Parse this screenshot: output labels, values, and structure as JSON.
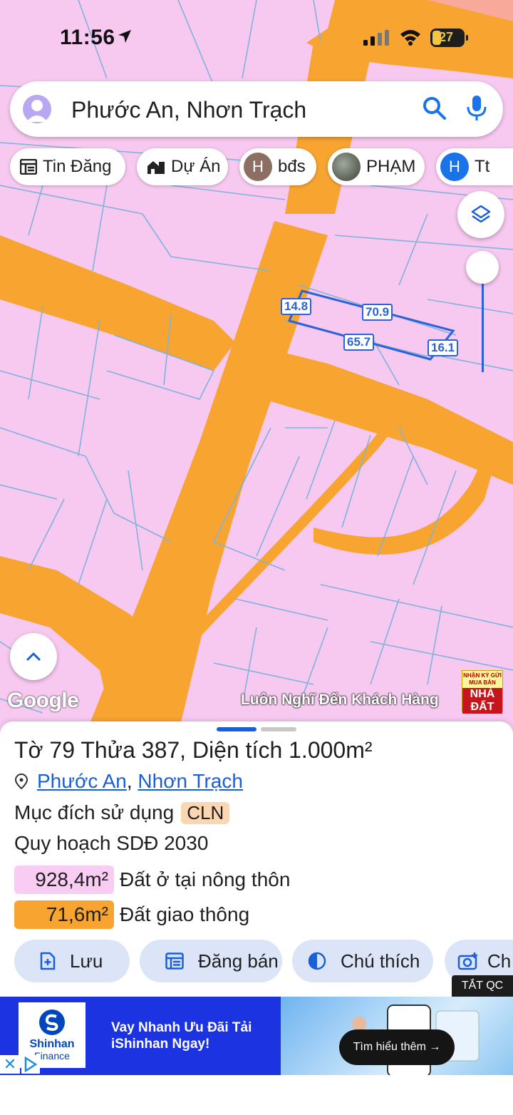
{
  "status_bar": {
    "time": "11:56",
    "battery": "27"
  },
  "search": {
    "query": "Phước An, Nhơn Trạch"
  },
  "chips": [
    {
      "label": "Tin Đăng",
      "icon": "listing-icon"
    },
    {
      "label": "Dự Án",
      "icon": "project-icon"
    },
    {
      "label": "bđs",
      "badge": "H",
      "badge_color": "#8d6e63"
    },
    {
      "label": "PHẠM",
      "icon": "photo-avatar"
    },
    {
      "label": "Tt",
      "badge": "H",
      "badge_color": "#1a73e8"
    }
  ],
  "map": {
    "dimensions": [
      "14.8",
      "70.9",
      "65.7",
      "16.1"
    ],
    "google_logo": "Google",
    "watermark": "Luôn Nghĩ Đến Khách Hàng",
    "watermark_badge_top": "NHẬN KÝ GỬI MUA BÁN",
    "watermark_badge_main": "NHÀ ĐẤT"
  },
  "parcel": {
    "title_prefix": "Tờ",
    "sheet_no": "79",
    "title_mid": "Thửa",
    "parcel_no": "387",
    "title_area_label": ", Diện tích",
    "area": "1.000m²",
    "ward": "Phước An",
    "district": "Nhơn Trạch",
    "purpose_label": "Mục đích sử dụng",
    "purpose_code": "CLN",
    "plan_label": "Quy hoạch SDĐ 2030",
    "areas": [
      {
        "value": "928,4m²",
        "label": "Đất ở tại nông thôn",
        "color": "#f9ccf3"
      },
      {
        "value": "71,6m²",
        "label": "Đất giao thông",
        "color": "#f7a431"
      }
    ]
  },
  "actions": [
    {
      "label": "Lưu",
      "icon": "save-icon"
    },
    {
      "label": "Đăng bán",
      "icon": "post-sale-icon"
    },
    {
      "label": "Chú thích",
      "icon": "legend-icon"
    },
    {
      "label": "Ch",
      "icon": "camera-icon"
    }
  ],
  "ad_close": "TẮT QC",
  "ad": {
    "brand": "Shinhan",
    "brand_sub": "Finance",
    "headline": "Vay Nhanh Ưu Đãi Tải iShinhan Ngay!",
    "cta": "Tìm hiểu thêm"
  },
  "colors": {
    "land": "#f7c8f0",
    "road": "#f7a431",
    "accent": "#1a5fd6",
    "parcel_line": "#2c62d9"
  }
}
